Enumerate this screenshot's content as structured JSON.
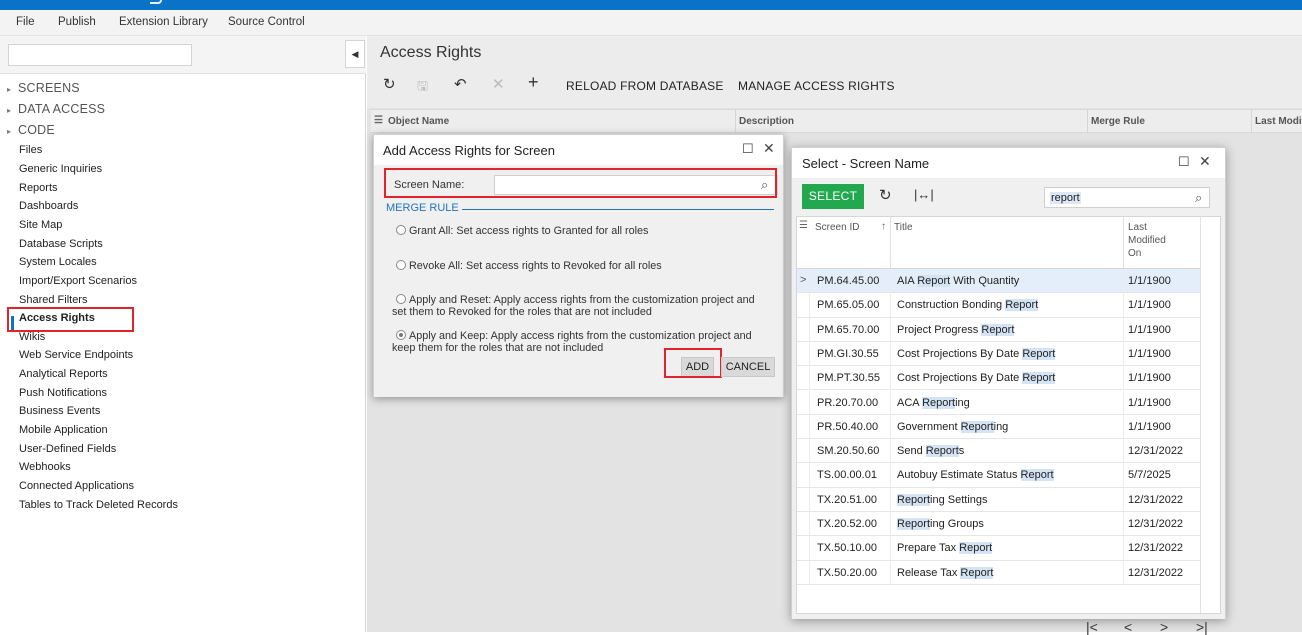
{
  "menu": [
    "File",
    "Publish",
    "Extension Library",
    "Source Control"
  ],
  "sidebar": {
    "collapse_glyph": "◀",
    "groups": [
      "SCREENS",
      "DATA ACCESS",
      "CODE"
    ],
    "items": [
      "Files",
      "Generic Inquiries",
      "Reports",
      "Dashboards",
      "Site Map",
      "Database Scripts",
      "System Locales",
      "Import/Export Scenarios",
      "Shared Filters",
      "Access Rights",
      "Wikis",
      "Web Service Endpoints",
      "Analytical Reports",
      "Push Notifications",
      "Business Events",
      "Mobile Application",
      "User-Defined Fields",
      "Webhooks",
      "Connected Applications",
      "Tables to Track Deleted Records"
    ],
    "active_item": "Access Rights"
  },
  "main": {
    "title": "Access Rights",
    "toolbar": {
      "reload": "RELOAD FROM DATABASE",
      "manage": "MANAGE ACCESS RIGHTS"
    },
    "columns": [
      "Object Name",
      "Description",
      "Merge Rule",
      "Last Modi"
    ]
  },
  "add_dialog": {
    "title": "Add Access Rights for Screen",
    "screen_name_label": "Screen Name:",
    "screen_name_value": "",
    "section": "MERGE RULE",
    "options": [
      {
        "line1": "Grant All: Set access rights to Granted for all roles",
        "line2": "",
        "checked": false
      },
      {
        "line1": "Revoke All: Set access rights to Revoked for all roles",
        "line2": "",
        "checked": false
      },
      {
        "line1": "Apply and Reset: Apply access rights from the customization project and",
        "line2": "set them to Revoked for the roles that are not included",
        "checked": false
      },
      {
        "line1": "Apply and Keep: Apply access rights from the customization project and",
        "line2": "keep them for the roles that are not included",
        "checked": true
      }
    ],
    "add_label": "ADD",
    "cancel_label": "CANCEL"
  },
  "select_dialog": {
    "title": "Select - Screen Name",
    "select_label": "SELECT",
    "search_value": "report",
    "columns": {
      "id": "Screen ID",
      "sort": "↑",
      "title": "Title",
      "modified_1": "Last",
      "modified_2": "Modified",
      "modified_3": "On"
    },
    "rows": [
      {
        "id": "PM.64.45.00",
        "t1": "AIA ",
        "m": "Report",
        "t2": " With Quantity",
        "date": "1/1/1900"
      },
      {
        "id": "PM.65.05.00",
        "t1": "Construction Bonding ",
        "m": "Report",
        "t2": "",
        "date": "1/1/1900"
      },
      {
        "id": "PM.65.70.00",
        "t1": "Project Progress ",
        "m": "Report",
        "t2": "",
        "date": "1/1/1900"
      },
      {
        "id": "PM.GI.30.55",
        "t1": "Cost Projections By Date ",
        "m": "Report",
        "t2": "",
        "date": "1/1/1900"
      },
      {
        "id": "PM.PT.30.55",
        "t1": "Cost Projections By Date ",
        "m": "Report",
        "t2": "",
        "date": "1/1/1900"
      },
      {
        "id": "PR.20.70.00",
        "t1": "ACA ",
        "m": "Report",
        "t2": "ing",
        "date": "1/1/1900"
      },
      {
        "id": "PR.50.40.00",
        "t1": "Government ",
        "m": "Report",
        "t2": "ing",
        "date": "1/1/1900"
      },
      {
        "id": "SM.20.50.60",
        "t1": "Send ",
        "m": "Report",
        "t2": "s",
        "date": "12/31/2022"
      },
      {
        "id": "TS.00.00.01",
        "t1": "Autobuy Estimate Status ",
        "m": "Report",
        "t2": "",
        "date": "5/7/2025"
      },
      {
        "id": "TX.20.51.00",
        "t1": "",
        "m": "Report",
        "t2": "ing Settings",
        "date": "12/31/2022"
      },
      {
        "id": "TX.20.52.00",
        "t1": "",
        "m": "Report",
        "t2": "ing Groups",
        "date": "12/31/2022"
      },
      {
        "id": "TX.50.10.00",
        "t1": "Prepare Tax ",
        "m": "Report",
        "t2": "",
        "date": "12/31/2022"
      },
      {
        "id": "TX.50.20.00",
        "t1": "Release Tax ",
        "m": "Report",
        "t2": "",
        "date": "12/31/2022"
      }
    ],
    "pager": [
      "|<",
      "<",
      ">",
      ">|"
    ]
  }
}
